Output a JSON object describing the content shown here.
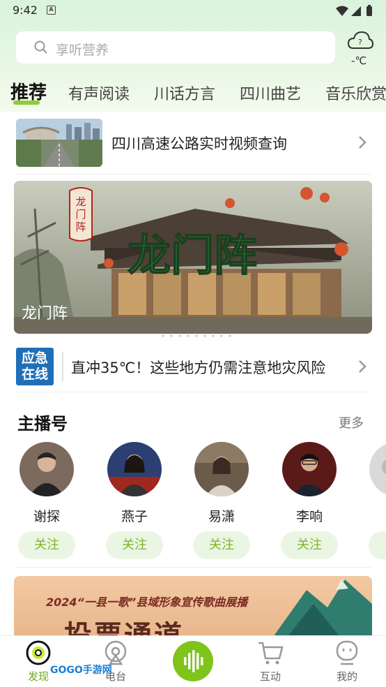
{
  "status_bar": {
    "time": "9:42",
    "a_glyph": "A"
  },
  "search": {
    "placeholder": "享听营养"
  },
  "weather": {
    "temp": "-℃",
    "icon": "cloud-question-icon"
  },
  "tabs": [
    {
      "label": "推荐",
      "active": true
    },
    {
      "label": "有声阅读"
    },
    {
      "label": "川话方言"
    },
    {
      "label": "四川曲艺"
    },
    {
      "label": "音乐欣赏"
    }
  ],
  "highway": {
    "label": "四川高速公路实时视频查询"
  },
  "banner": {
    "caption": "龙门阵",
    "art_text": "龙门阵",
    "seal_text": "龙门阵",
    "dot_count": 10,
    "active_dot": 0
  },
  "news": {
    "logo_line1": "应急",
    "logo_line2": "在线",
    "headline": "直冲35℃！这些地方仍需注意地灾风险"
  },
  "anchors_section": {
    "title": "主播号",
    "more": "更多"
  },
  "anchors": [
    {
      "name": "谢探",
      "follow": "关注"
    },
    {
      "name": "燕子",
      "follow": "关注"
    },
    {
      "name": "易潇",
      "follow": "关注"
    },
    {
      "name": "李响",
      "follow": "关注"
    }
  ],
  "promo": {
    "top_line": "2024“一县一歌”县域形象宣传歌曲展播",
    "big_text": "投票通道"
  },
  "bottom_nav": [
    {
      "label": "发现",
      "active": true
    },
    {
      "label": "电台"
    },
    {
      "label": ""
    },
    {
      "label": "互动"
    },
    {
      "label": "我的"
    }
  ],
  "watermark": "GOGO手游网",
  "colors": {
    "accent": "#7ec41b",
    "accent_text": "#7cb72c",
    "follow_bg": "#ebf5e3",
    "news_logo": "#1f6fb8"
  }
}
